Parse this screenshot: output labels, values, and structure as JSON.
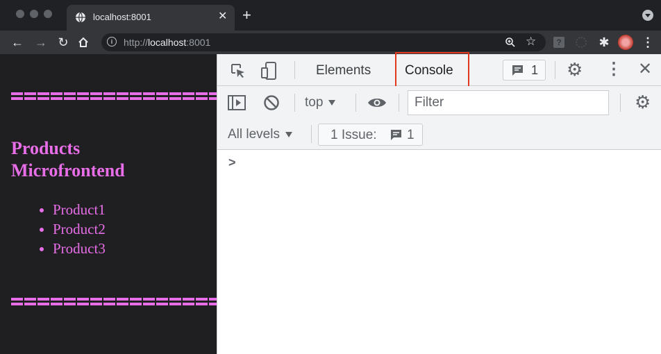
{
  "browser": {
    "tab_title": "localhost:8001",
    "url_scheme": "http://",
    "url_host": "localhost",
    "url_port": ":8001"
  },
  "page": {
    "heading_line1": "Products",
    "heading_line2": "Microfrontend",
    "products": [
      "Product1",
      "Product2",
      "Product3"
    ],
    "accent_color": "#e86ee8"
  },
  "devtools": {
    "tabs": [
      "Elements",
      "Console"
    ],
    "active_tab": "Console",
    "messages_count": "1",
    "context": "top",
    "filter_placeholder": "Filter",
    "log_level": "All levels",
    "issues_label": "1 Issue:",
    "issues_count": "1",
    "prompt_symbol": ">",
    "highlight_color": "#e2371f"
  }
}
